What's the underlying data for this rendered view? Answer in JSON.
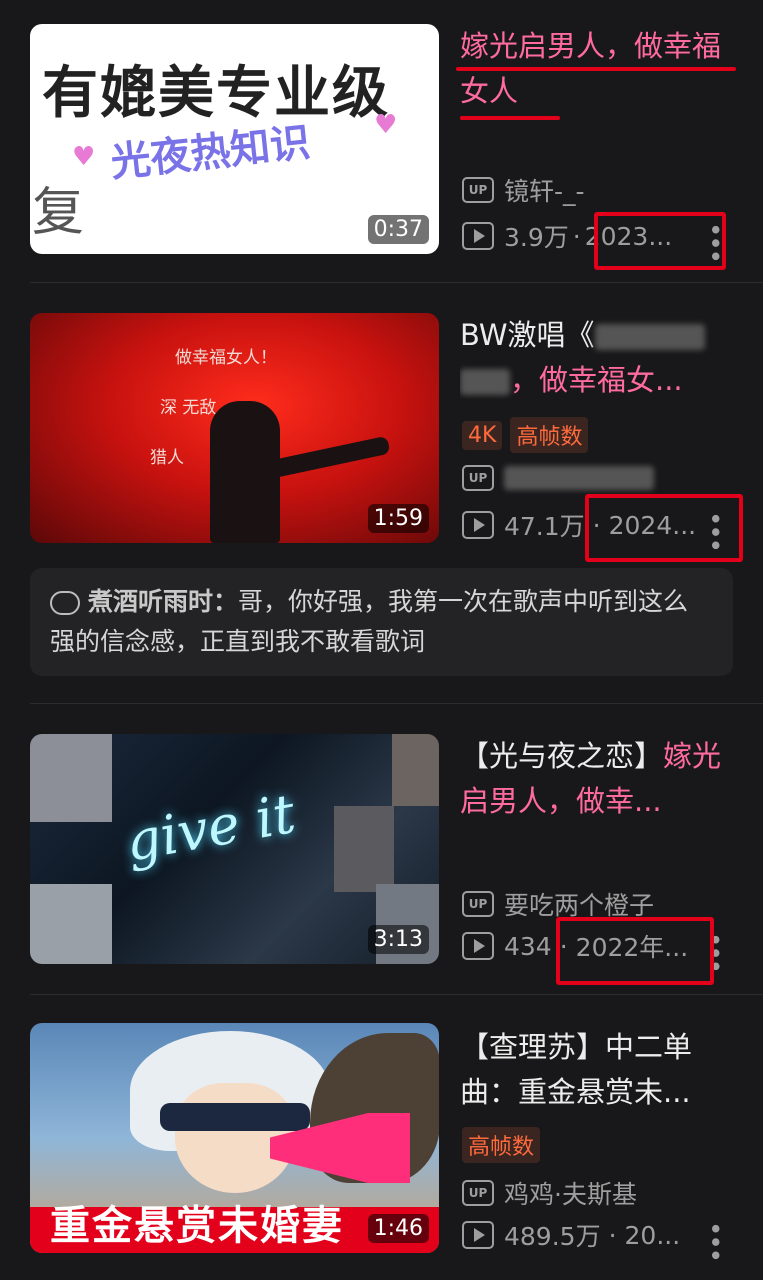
{
  "videos": [
    {
      "thumb_text_top": "有媲美专业级",
      "thumb_text_mid": "光夜热知识",
      "thumb_text_low": "复",
      "duration": "0:37",
      "title_pink": "嫁光启男人，做幸福女人",
      "uploader": "镜轩-_-",
      "views": "3.9万",
      "date": "2023..."
    },
    {
      "thumb_lines": [
        "做幸福女人！",
        "深 无敌，",
        "猎人"
      ],
      "duration": "1:59",
      "title_plain": "BW激唱《",
      "title_pink": "，做幸福女...",
      "tags": [
        "4K",
        "高帧数"
      ],
      "views": "47.1万",
      "date": "2024...",
      "comment_author": "煮酒听雨时：",
      "comment_text": "哥，你好强，我第一次在歌声中听到这么强的信念感，正直到我不敢看歌词"
    },
    {
      "thumb_text": "give it",
      "duration": "3:13",
      "title_plain": "【光与夜之恋】",
      "title_pink_1": "嫁",
      "title_pink_2": "光启男人，做幸...",
      "uploader": "要吃两个橙子",
      "views": "434",
      "date": "2022年..."
    },
    {
      "thumb_banner": "重金悬赏未婚妻",
      "duration": "1:46",
      "title_plain": "【查理苏】中二单曲：重金悬赏未...",
      "tags": [
        "高帧数"
      ],
      "uploader": "鸡鸡·夫斯基",
      "views": "489.5万",
      "date": "20..."
    }
  ],
  "labels": {
    "up": "UP",
    "separator": "·"
  },
  "colors": {
    "accent_pink": "#ff6b9e",
    "highlight_red": "#e3001b",
    "background": "#18181a"
  }
}
